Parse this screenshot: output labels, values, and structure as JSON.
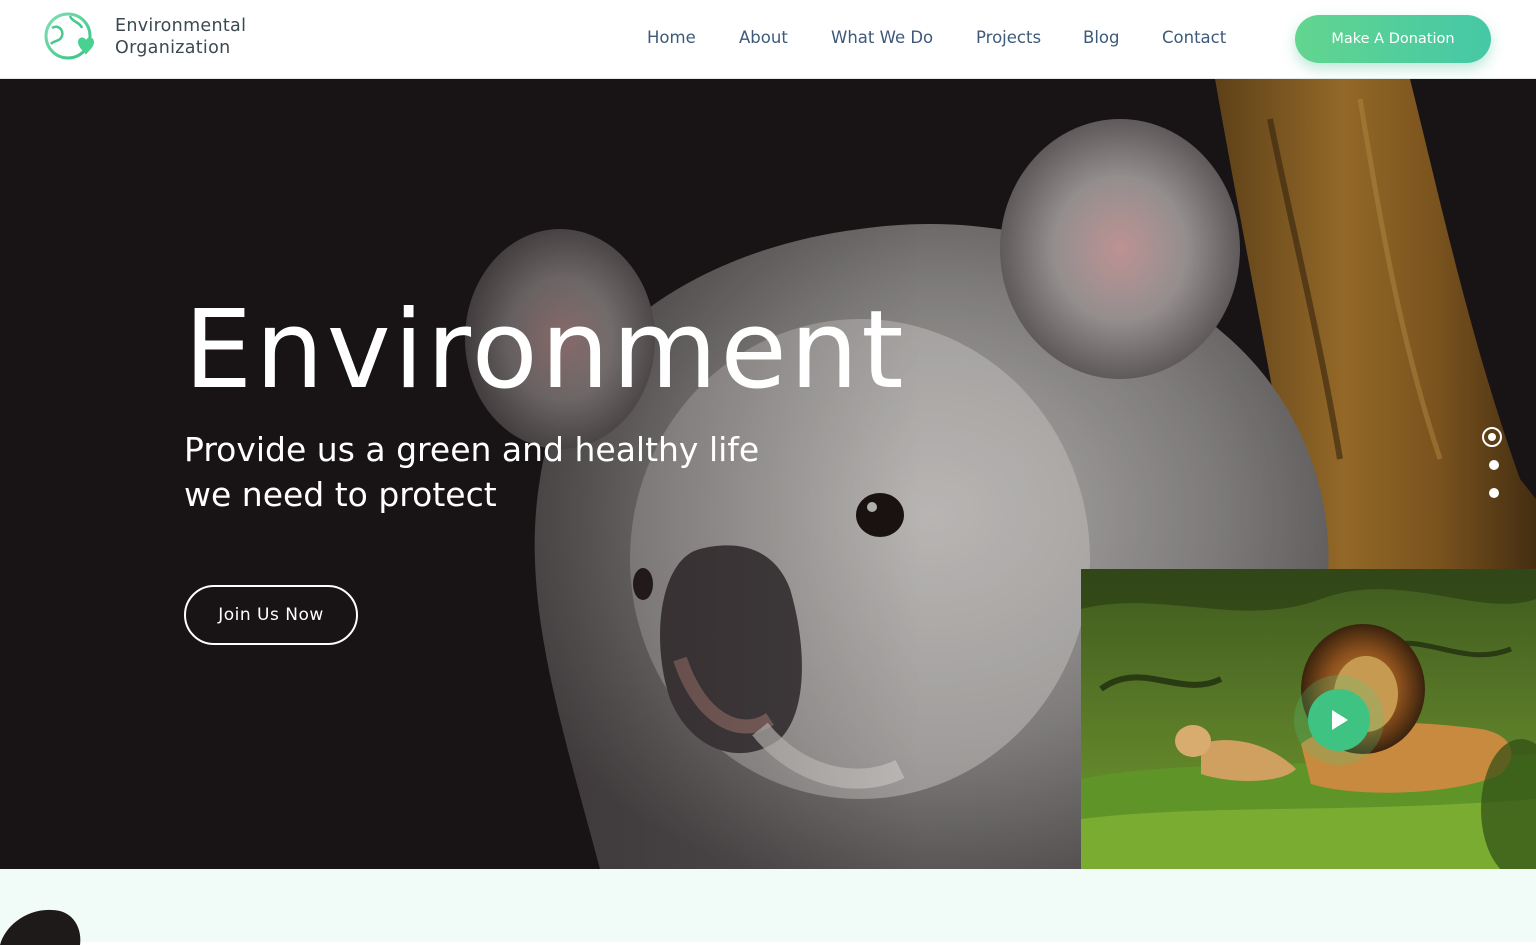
{
  "header": {
    "logo": {
      "line1": "Environmental",
      "line2": "Organization",
      "icon": "globe-heart-icon"
    },
    "nav": [
      {
        "label": "Home"
      },
      {
        "label": "About"
      },
      {
        "label": "What We Do"
      },
      {
        "label": "Projects"
      },
      {
        "label": "Blog"
      },
      {
        "label": "Contact"
      }
    ],
    "donate_label": "Make A Donation"
  },
  "hero": {
    "title": "Environment",
    "subtitle_line1": "Provide us a green and healthy life",
    "subtitle_line2": "we need to protect",
    "cta_label": "Join Us Now",
    "background_image": "koala-on-tree-photo",
    "slider": {
      "slides": 3,
      "active": 1
    },
    "video": {
      "thumbnail": "lions-in-forest-photo",
      "icon": "play-icon"
    }
  },
  "colors": {
    "brand_green": "#4fcf93",
    "nav_text": "#3d5a7a",
    "hero_dark": "#1c1617",
    "section_tint": "#f1fcf8"
  }
}
